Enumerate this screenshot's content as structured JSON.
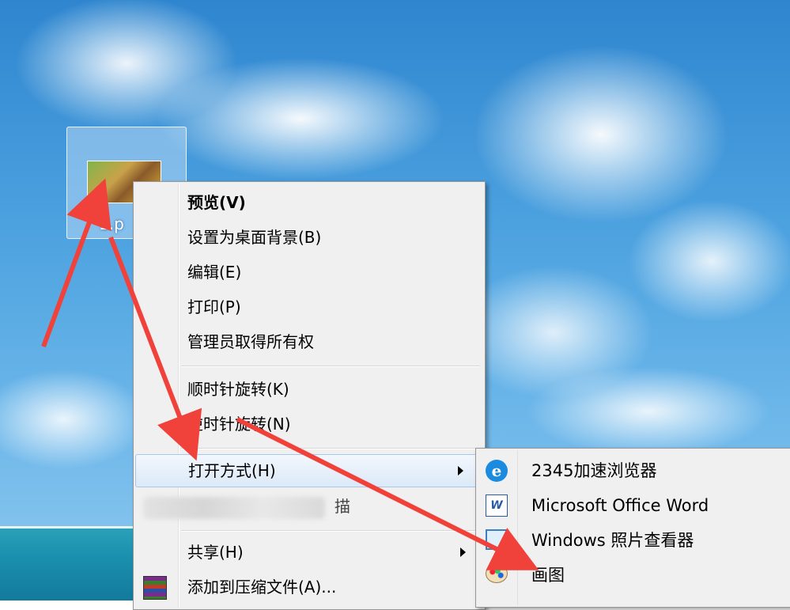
{
  "desktop": {
    "file": {
      "label": "1.p"
    }
  },
  "context_menu": {
    "items": [
      {
        "label": "预览(V)"
      },
      {
        "label": "设置为桌面背景(B)"
      },
      {
        "label": "编辑(E)"
      },
      {
        "label": "打印(P)"
      },
      {
        "label": "管理员取得所有权"
      },
      {
        "label": "顺时针旋转(K)"
      },
      {
        "label": "逆时针旋转(N)"
      },
      {
        "label": "打开方式(H)"
      },
      {
        "label": "描"
      },
      {
        "label": "共享(H)"
      },
      {
        "label": "添加到压缩文件(A)..."
      }
    ]
  },
  "open_with_submenu": {
    "items": [
      {
        "label": "2345加速浏览器",
        "icon": "ie-icon"
      },
      {
        "label": "Microsoft Office Word",
        "icon": "word-icon"
      },
      {
        "label": "Windows 照片查看器",
        "icon": "photo-viewer-icon"
      },
      {
        "label": "画图",
        "icon": "paint-icon"
      }
    ]
  },
  "colors": {
    "annotation_arrow": "#f0413a",
    "menu_bg": "#f0f0f0",
    "highlight_border": "#a8c7ee"
  }
}
